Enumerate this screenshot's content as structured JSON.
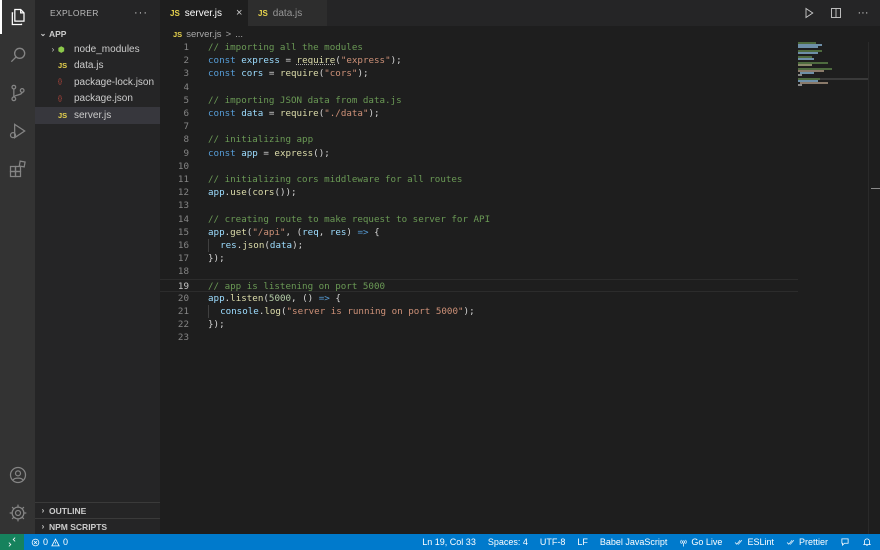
{
  "explorer": {
    "title": "EXPLORER",
    "more": "···",
    "root": "APP",
    "items": [
      {
        "label": "node_modules",
        "icon": "node",
        "folder": true
      },
      {
        "label": "data.js",
        "icon": "JS"
      },
      {
        "label": "package-lock.json",
        "icon": "{}"
      },
      {
        "label": "package.json",
        "icon": "{}"
      },
      {
        "label": "server.js",
        "icon": "JS",
        "selected": true
      }
    ],
    "outline": "OUTLINE",
    "npm_scripts": "NPM SCRIPTS"
  },
  "tabs": [
    {
      "icon": "JS",
      "label": "server.js",
      "close": "×",
      "active": true
    },
    {
      "icon": "JS",
      "label": "data.js",
      "active": false
    }
  ],
  "breadcrumb": {
    "icon": "JS",
    "file": "server.js",
    "sep": ">",
    "rest": "..."
  },
  "editor": {
    "current_line": 19,
    "lines": [
      {
        "n": "1",
        "tokens": [
          [
            "c",
            "// importing all the modules"
          ]
        ]
      },
      {
        "n": "2",
        "tokens": [
          [
            "k",
            "const "
          ],
          [
            "v",
            "express"
          ],
          [
            "p",
            " = "
          ],
          [
            "fsq",
            "require"
          ],
          [
            "p",
            "("
          ],
          [
            "s",
            "\"express\""
          ],
          [
            "p",
            ");"
          ]
        ]
      },
      {
        "n": "3",
        "tokens": [
          [
            "k",
            "const "
          ],
          [
            "v",
            "cors"
          ],
          [
            "p",
            " = "
          ],
          [
            "f",
            "require"
          ],
          [
            "p",
            "("
          ],
          [
            "s",
            "\"cors\""
          ],
          [
            "p",
            ");"
          ]
        ]
      },
      {
        "n": "4",
        "tokens": []
      },
      {
        "n": "5",
        "tokens": [
          [
            "c",
            "// importing JSON data from data.js"
          ]
        ]
      },
      {
        "n": "6",
        "tokens": [
          [
            "k",
            "const "
          ],
          [
            "v",
            "data"
          ],
          [
            "p",
            " = "
          ],
          [
            "f",
            "require"
          ],
          [
            "p",
            "("
          ],
          [
            "s",
            "\"./data\""
          ],
          [
            "p",
            ");"
          ]
        ]
      },
      {
        "n": "7",
        "tokens": []
      },
      {
        "n": "8",
        "tokens": [
          [
            "c",
            "// initializing app"
          ]
        ]
      },
      {
        "n": "9",
        "tokens": [
          [
            "k",
            "const "
          ],
          [
            "v",
            "app"
          ],
          [
            "p",
            " = "
          ],
          [
            "f",
            "express"
          ],
          [
            "p",
            "();"
          ]
        ]
      },
      {
        "n": "10",
        "tokens": []
      },
      {
        "n": "11",
        "tokens": [
          [
            "c",
            "// initializing cors middleware for all routes"
          ]
        ]
      },
      {
        "n": "12",
        "tokens": [
          [
            "v",
            "app"
          ],
          [
            "p",
            "."
          ],
          [
            "f",
            "use"
          ],
          [
            "p",
            "("
          ],
          [
            "f",
            "cors"
          ],
          [
            "p",
            "());"
          ]
        ]
      },
      {
        "n": "13",
        "tokens": []
      },
      {
        "n": "14",
        "tokens": [
          [
            "c",
            "// creating route to make request to server for API"
          ]
        ]
      },
      {
        "n": "15",
        "tokens": [
          [
            "v",
            "app"
          ],
          [
            "p",
            "."
          ],
          [
            "f",
            "get"
          ],
          [
            "p",
            "("
          ],
          [
            "s",
            "\"/api\""
          ],
          [
            "p",
            ", ("
          ],
          [
            "v",
            "req"
          ],
          [
            "p",
            ", "
          ],
          [
            "v",
            "res"
          ],
          [
            "p",
            ") "
          ],
          [
            "k",
            "=>"
          ],
          [
            "p",
            " {"
          ]
        ]
      },
      {
        "n": "16",
        "tokens": [
          [
            "g",
            "  "
          ],
          [
            "v",
            "res"
          ],
          [
            "p",
            "."
          ],
          [
            "f",
            "json"
          ],
          [
            "p",
            "("
          ],
          [
            "v",
            "data"
          ],
          [
            "p",
            ");"
          ]
        ]
      },
      {
        "n": "17",
        "tokens": [
          [
            "p",
            "});"
          ]
        ]
      },
      {
        "n": "18",
        "tokens": []
      },
      {
        "n": "19",
        "tokens": [
          [
            "c",
            "// app is listening on port 5000"
          ]
        ]
      },
      {
        "n": "20",
        "tokens": [
          [
            "v",
            "app"
          ],
          [
            "p",
            "."
          ],
          [
            "f",
            "listen"
          ],
          [
            "p",
            "("
          ],
          [
            "n",
            "5000"
          ],
          [
            "p",
            ", () "
          ],
          [
            "k",
            "=>"
          ],
          [
            "p",
            " {"
          ]
        ]
      },
      {
        "n": "21",
        "tokens": [
          [
            "g",
            "  "
          ],
          [
            "v",
            "console"
          ],
          [
            "p",
            "."
          ],
          [
            "f",
            "log"
          ],
          [
            "p",
            "("
          ],
          [
            "s",
            "\"server is running on port 5000\""
          ],
          [
            "p",
            ");"
          ]
        ]
      },
      {
        "n": "22",
        "tokens": [
          [
            "p",
            "});"
          ]
        ]
      },
      {
        "n": "23",
        "tokens": []
      }
    ]
  },
  "status": {
    "errors": "0",
    "warnings": "0",
    "cursor": "Ln 19, Col 33",
    "spaces": "Spaces: 4",
    "encoding": "UTF-8",
    "eol": "LF",
    "language": "Babel JavaScript",
    "golive": "Go Live",
    "eslint": "ESLint",
    "prettier": "Prettier"
  },
  "colors": {
    "statusbar": "#007acc",
    "remote": "#16825d",
    "activitybar": "#333333",
    "sidebar": "#252526",
    "editor": "#1e1e1e"
  }
}
